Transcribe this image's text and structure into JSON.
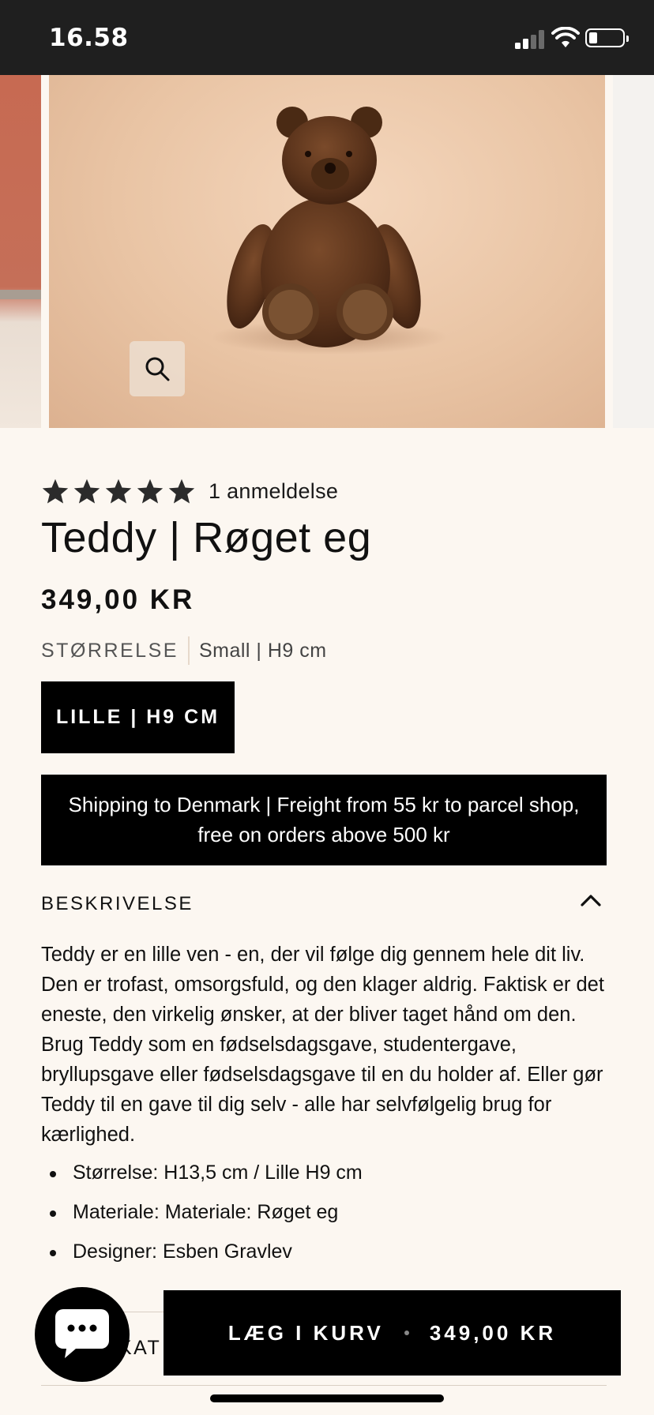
{
  "status_bar": {
    "time": "16.58"
  },
  "product": {
    "rating": 5,
    "review_count": "1 anmeldelse",
    "title": "Teddy | Røget eg",
    "price": "349,00 KR",
    "size_label": "STØRRELSE",
    "size_value": "Small | H9 cm",
    "size_option": "LILLE | H9 CM"
  },
  "shipping": {
    "line1": "Shipping to Denmark | Freight from 55 kr to parcel shop,",
    "line2": "free on orders above 500 kr"
  },
  "description": {
    "heading": "BESKRIVELSE",
    "text": "Teddy er en lille ven - en, der vil følge dig gennem hele dit liv. Den er trofast, omsorgsfuld, og den klager aldrig. Faktisk er det eneste, den virkelig ønsker, at der bliver taget hånd om den. Brug Teddy som en fødselsdagsgave, studentergave, bryllupsgave eller fødselsdagsgave til en du holder af. Eller gør Teddy til en gave til dig selv - alle har selvfølgelig brug for kærlighed.",
    "bullets": [
      "Størrelse: H13,5 cm / Lille H9 cm",
      "Materiale: Materiale: Røget eg",
      "Designer: Esben Gravlev"
    ]
  },
  "next_section_partial": "KAT",
  "cart_bar": {
    "label": "LÆG I KURV",
    "price": "349,00 KR"
  },
  "icons": {
    "zoom": "magnifier-icon",
    "collapse": "chevron-up-icon",
    "chat": "chat-bubble-icon",
    "star": "star-icon"
  },
  "colors": {
    "background": "#fcf7f1",
    "button": "#000000",
    "status_bar": "#1f1f1f"
  }
}
